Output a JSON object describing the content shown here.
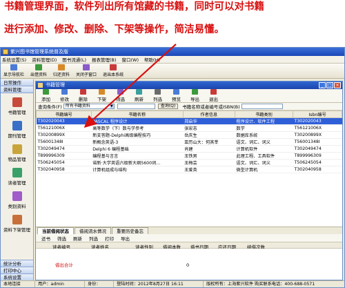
{
  "caption": {
    "line1": "书籍管理界面，软件列出所有馆藏的书籍，同时可以对书籍",
    "line2": "进行添加、修改、删除、下架等操作，简洁易懂。"
  },
  "app": {
    "title": "紫兴图书馆管理系统普及版"
  },
  "menu": [
    "系统设置(S)",
    "资料管理(D)",
    "图书流通(L)",
    "报表管理(B)",
    "窗口(W)",
    "帮助(H)"
  ],
  "toolbar": [
    {
      "label": "显示导航栏",
      "color": "#4a7bd6"
    },
    {
      "label": "出借资料",
      "color": "#3c9a3c"
    },
    {
      "label": "归还资料",
      "color": "#d68a2a"
    },
    {
      "label": "关闭子窗口",
      "color": "#8a5cc8"
    },
    {
      "label": "退出本系统",
      "color": "#c83a3a"
    }
  ],
  "sidebar": {
    "headers": [
      "日常操作",
      "资料管理"
    ],
    "items": [
      {
        "label": "书籍管理",
        "color": "#c84a3a"
      },
      {
        "label": "期刊管理",
        "color": "#3a6fc8"
      },
      {
        "label": "物品管理",
        "color": "#c8a43a"
      },
      {
        "label": "读者管理",
        "color": "#3aa06a"
      },
      {
        "label": "类别资料",
        "color": "#a05cc8"
      },
      {
        "label": "资料下架管理",
        "color": "#c8703a"
      }
    ],
    "footers": [
      "统计分析",
      "打印中心",
      "系统设置"
    ]
  },
  "book_window": {
    "title": "书籍管理",
    "toolbar": [
      {
        "label": "添加",
        "color": "#3c9a3c"
      },
      {
        "label": "修改",
        "color": "#4a7bd6"
      },
      {
        "label": "删除",
        "color": "#c83a3a"
      },
      {
        "label": "下架",
        "color": "#d68a2a"
      },
      {
        "label": "筛选",
        "color": "#8a5cc8"
      },
      {
        "label": "刷新",
        "color": "#3aa0a0"
      },
      {
        "label": "列选",
        "color": "#6a6a6a"
      },
      {
        "label": "预览",
        "color": "#4a7bd6"
      },
      {
        "label": "导出",
        "color": "#3c9a3c"
      },
      {
        "label": "退出",
        "color": "#c83a3a"
      }
    ],
    "query": {
      "label": "查询条件(F)",
      "select_value": "所有书籍资料",
      "button": "查询(Q)",
      "hint": "书籍名称或者编号或ISBN(B)"
    },
    "columns": [
      "书籍编号",
      "书籍名称",
      "作者信息",
      "书籍类别",
      "Isbn编号"
    ],
    "rows": [
      [
        "T302020043",
        "PASCAL 程序设计",
        "郑启华",
        "程序设计、软件工程",
        "T302020043"
      ],
      [
        "T56121006X",
        "高等数学（下）数与学参考",
        "张宏志",
        "数学",
        "T56121006X"
      ],
      [
        "T30200899X",
        "新支答题-Delphi高级编程技巧",
        "岳庆生",
        "数据库系统",
        "T30200899X"
      ],
      [
        "T56001348I",
        "新概念英语-3",
        "亚历山大：何其莘",
        "语文、词汇、词义",
        "T56001348I"
      ],
      [
        "T302049474",
        "Delphi 6 编程基础",
        "肖建",
        "计算机软件",
        "T302049474"
      ],
      [
        "T899996309",
        "编程基与言言",
        "王铁男",
        "此理工程、工具软件",
        "T899996309"
      ],
      [
        "T506245054",
        "诺新·大学英语六级新大纲5600词…",
        "王梅芸",
        "语文、词汇、词义",
        "T506245054"
      ],
      [
        "T302040958",
        "计算机组成与结构",
        "王爱英",
        "微型计算机",
        "T302040958"
      ]
    ],
    "tabs": [
      "当前借阅状态",
      "借阅流水情况",
      "重要历史备忘"
    ],
    "sub_toolbar": [
      "还书",
      "筛选",
      "刷新",
      "列选",
      "打印",
      "导出"
    ],
    "sub_columns": [
      "读者编号",
      "读者姓名",
      "读者性别",
      "借阅本数",
      "借书日期",
      "应还日期",
      "续借次数"
    ],
    "total_label": "借出合计",
    "total_value": "0"
  },
  "statusbar": {
    "status": "本地连接",
    "user": "用户：admin",
    "field2": "身份：",
    "login_time": "登陆时间：2012年8月27日 16:11",
    "copyright": "版权所有：上海紫兴软件 购买联系电话：400-688-0571"
  }
}
